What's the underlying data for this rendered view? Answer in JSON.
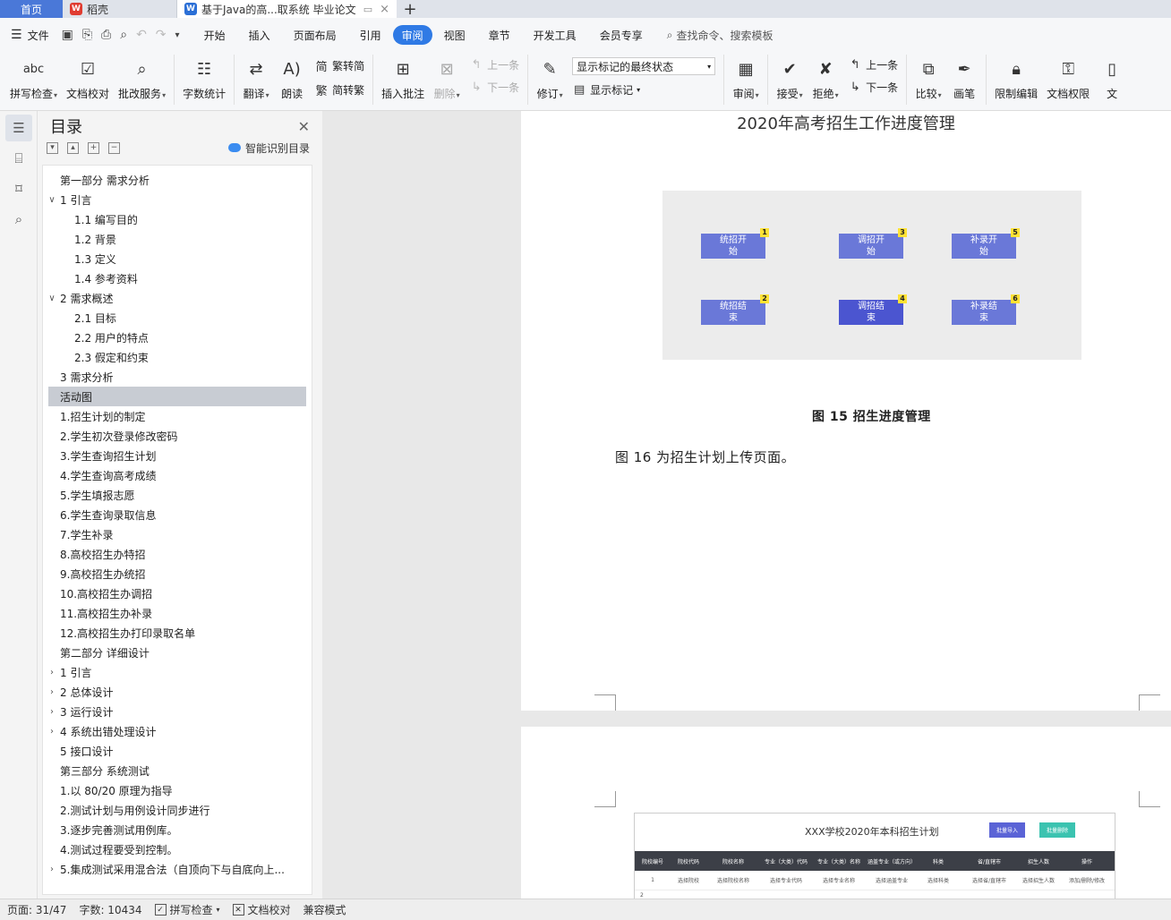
{
  "tabs": {
    "home": "首页",
    "app": "稻壳",
    "app_icon": "W",
    "doc": "基于Java的高...取系统 毕业论文",
    "doc_icon": "W",
    "add": "+",
    "close": "×"
  },
  "menubar": {
    "file": "文件",
    "items": [
      "开始",
      "插入",
      "页面布局",
      "引用",
      "审阅",
      "视图",
      "章节",
      "开发工具",
      "会员专享"
    ],
    "active": "审阅",
    "search": "查找命令、搜索模板"
  },
  "ribbon": {
    "spell": "拼写检查",
    "doc_check": "文档校对",
    "batch": "批改服务",
    "word_count": "字数统计",
    "translate": "翻译",
    "read_aloud": "朗读",
    "trad_to_simp": "繁转简",
    "simp_to_trad": "简转繁",
    "insert_comment": "插入批注",
    "delete": "删除",
    "prev_comment": "上一条",
    "next_comment": "下一条",
    "revise": "修订",
    "display_state": "显示标记的最终状态",
    "show_marks": "显示标记",
    "review": "审阅",
    "accept": "接受",
    "reject": "拒绝",
    "prev_change": "上一条",
    "next_change": "下一条",
    "compare": "比较",
    "pen": "画笔",
    "restrict_edit": "限制编辑",
    "doc_rights": "文档权限",
    "doc_cut": "文"
  },
  "nav": {
    "title": "目录",
    "smart": "智能识别目录",
    "items": [
      {
        "text": "第一部分  需求分析",
        "indent": 0,
        "chev": ""
      },
      {
        "text": "1   引言",
        "indent": 0,
        "chev": "v"
      },
      {
        "text": "1.1    编写目的",
        "indent": 1,
        "chev": ""
      },
      {
        "text": "1.2  背景",
        "indent": 1,
        "chev": ""
      },
      {
        "text": "1.3     定义",
        "indent": 1,
        "chev": ""
      },
      {
        "text": "1.4     参考资料",
        "indent": 1,
        "chev": ""
      },
      {
        "text": "2    需求概述",
        "indent": 0,
        "chev": "v"
      },
      {
        "text": "2.1  目标",
        "indent": 1,
        "chev": ""
      },
      {
        "text": "2.2     用户的特点",
        "indent": 1,
        "chev": ""
      },
      {
        "text": "2.3     假定和约束",
        "indent": 1,
        "chev": ""
      },
      {
        "text": "3  需求分析",
        "indent": 0,
        "chev": ""
      },
      {
        "text": "活动图",
        "indent": 0,
        "chev": "",
        "selected": true
      },
      {
        "text": "1.招生计划的制定",
        "indent": 0,
        "chev": ""
      },
      {
        "text": "2.学生初次登录修改密码",
        "indent": 0,
        "chev": ""
      },
      {
        "text": "3.学生查询招生计划",
        "indent": 0,
        "chev": ""
      },
      {
        "text": "4.学生查询高考成绩",
        "indent": 0,
        "chev": ""
      },
      {
        "text": "5.学生填报志愿",
        "indent": 0,
        "chev": ""
      },
      {
        "text": "6.学生查询录取信息",
        "indent": 0,
        "chev": ""
      },
      {
        "text": "7.学生补录",
        "indent": 0,
        "chev": ""
      },
      {
        "text": "8.高校招生办特招",
        "indent": 0,
        "chev": ""
      },
      {
        "text": "9.高校招生办统招",
        "indent": 0,
        "chev": ""
      },
      {
        "text": "10.高校招生办调招",
        "indent": 0,
        "chev": ""
      },
      {
        "text": "11.高校招生办补录",
        "indent": 0,
        "chev": ""
      },
      {
        "text": "12.高校招生办打印录取名单",
        "indent": 0,
        "chev": ""
      },
      {
        "text": "第二部分  详细设计",
        "indent": 0,
        "chev": ""
      },
      {
        "text": "1  引言",
        "indent": 0,
        "chev": ">"
      },
      {
        "text": "2  总体设计",
        "indent": 0,
        "chev": ">"
      },
      {
        "text": "3  运行设计",
        "indent": 0,
        "chev": ">"
      },
      {
        "text": "4  系统出错处理设计",
        "indent": 0,
        "chev": ">"
      },
      {
        "text": "5  接口设计",
        "indent": 0,
        "chev": ""
      },
      {
        "text": "第三部分  系统测试",
        "indent": 0,
        "chev": ""
      },
      {
        "text": "1.以  80/20  原理为指导",
        "indent": 0,
        "chev": ""
      },
      {
        "text": "2.测试计划与用例设计同步进行",
        "indent": 0,
        "chev": ""
      },
      {
        "text": "3.逐步完善测试用例库。",
        "indent": 0,
        "chev": ""
      },
      {
        "text": "4.测试过程要受到控制。",
        "indent": 0,
        "chev": ""
      },
      {
        "text": "5.集成测试采用混合法（自顶向下与自底向上...",
        "indent": 0,
        "chev": ">"
      }
    ]
  },
  "document": {
    "heading": "2020年高考招生工作进度管理",
    "nodes": [
      {
        "line1": "统招开",
        "line2": "始",
        "badge": "1"
      },
      {
        "line1": "调招开",
        "line2": "始",
        "badge": "3"
      },
      {
        "line1": "补录开",
        "line2": "始",
        "badge": "5"
      },
      {
        "line1": "统招结",
        "line2": "束",
        "badge": "2"
      },
      {
        "line1": "调招结",
        "line2": "束",
        "badge": "4"
      },
      {
        "line1": "补录结",
        "line2": "束",
        "badge": "6"
      }
    ],
    "caption": "图 15 招生进度管理",
    "paragraph": "图 16 为招生计划上传页面。",
    "plan": {
      "title": "XXX学校2020年本科招生计划",
      "btn_import": "批量导入",
      "btn_delete": "批量删除",
      "headers": [
        "院校编号",
        "院校代码",
        "院校名称",
        "专业（大类）代码",
        "专业（大类）名称",
        "涵盖专业（或方向）",
        "科类",
        "省/直辖市",
        "招生人数",
        "操作"
      ],
      "row": [
        "1",
        "选择院校",
        "选择院校名称",
        "选择专业代码",
        "选择专业名称",
        "选择涵盖专业",
        "选择科类",
        "选择省/直辖市",
        "选择招生人数",
        "添加/删除/修改"
      ],
      "row2": "2"
    }
  },
  "status": {
    "page": "页面: 31/47",
    "words": "字数: 10434",
    "spell": "拼写检查",
    "doc_check": "文档校对",
    "compat": "兼容模式"
  },
  "colors": {
    "accent": "#2f7ae5",
    "node": "#6a78d8",
    "node_dark": "#4b55d0",
    "badge": "#ffe234"
  }
}
